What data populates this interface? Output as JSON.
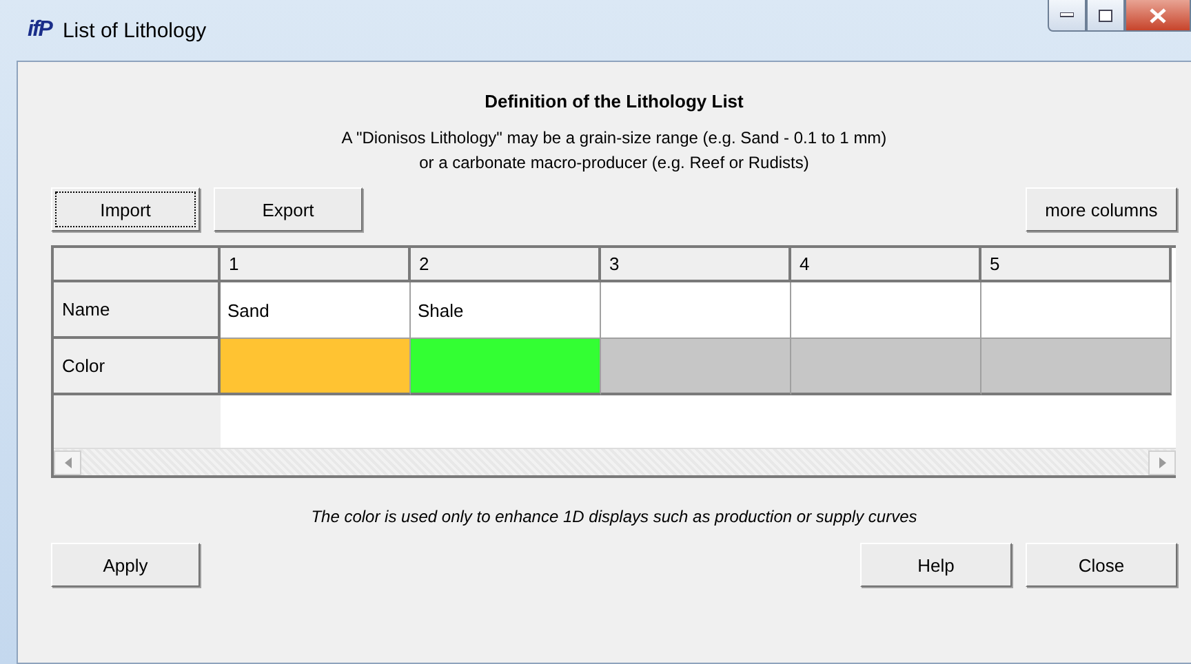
{
  "window": {
    "logo": "ifP",
    "title": "List of Lithology"
  },
  "heading": "Definition of the Lithology List",
  "description": [
    "A \"Dionisos Lithology\" may be a grain-size range (e.g. Sand - 0.1 to 1 mm)",
    "or a carbonate macro-producer (e.g. Reef or Rudists)"
  ],
  "toolbar": {
    "left": [
      {
        "label": "Import",
        "focused": true
      },
      {
        "label": "Export",
        "focused": false
      }
    ],
    "right": [
      {
        "label": "more columns",
        "focused": false
      }
    ]
  },
  "table": {
    "columns": [
      "1",
      "2",
      "3",
      "4",
      "5"
    ],
    "rows": [
      {
        "header": "Name",
        "kind": "text",
        "cells": [
          "Sand",
          "Shale",
          "",
          "",
          ""
        ]
      },
      {
        "header": "Color",
        "kind": "color",
        "cells": [
          {
            "color": "#ffc332"
          },
          {
            "color": "#33ff33"
          },
          {
            "color": "#c6c6c6"
          },
          {
            "color": "#c6c6c6"
          },
          {
            "color": "#c6c6c6"
          }
        ]
      }
    ]
  },
  "note": "The color is used only to enhance 1D displays such as production or supply curves",
  "buttons": {
    "left": [
      "Apply"
    ],
    "right": [
      "Help",
      "Close"
    ]
  }
}
